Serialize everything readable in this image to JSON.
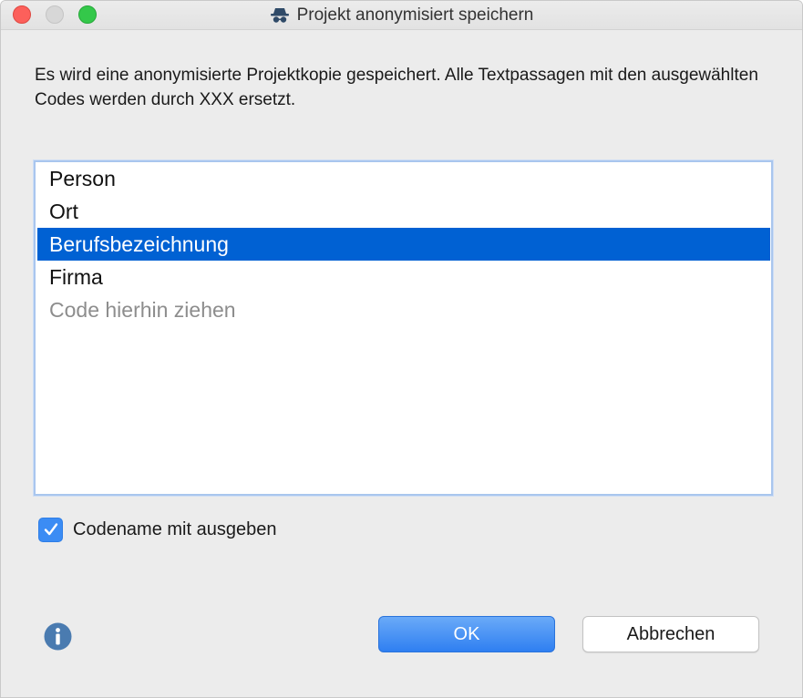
{
  "window": {
    "title": "Projekt anonymisiert speichern",
    "title_icon": "spy-icon"
  },
  "dialog": {
    "description": "Es wird eine anonymisierte Projektkopie gespeichert. Alle Textpassagen mit den ausgewählten Codes werden durch XXX ersetzt.",
    "codes": [
      {
        "label": "Person",
        "selected": false
      },
      {
        "label": "Ort",
        "selected": false
      },
      {
        "label": "Berufsbezeichnung",
        "selected": true
      },
      {
        "label": "Firma",
        "selected": false
      }
    ],
    "drop_placeholder": "Code hierhin ziehen",
    "checkbox": {
      "label": "Codename mit ausgeben",
      "checked": true
    }
  },
  "buttons": {
    "ok_label": "OK",
    "cancel_label": "Abbrechen"
  },
  "colors": {
    "selection": "#0061d3",
    "accent": "#3b8cf4",
    "info_icon": "#4a7bb0"
  }
}
